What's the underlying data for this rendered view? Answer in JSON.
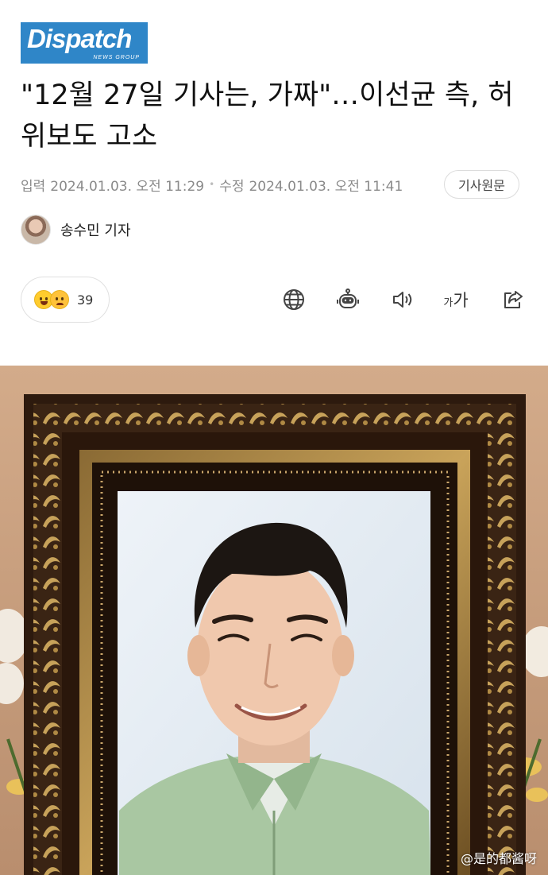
{
  "brand": {
    "logo_text": "Dispatch",
    "logo_sub": "NEWS GROUP"
  },
  "article": {
    "headline": "\"12월 27일 기사는, 가짜\"…이선균 측, 허위보도 고소",
    "meta": {
      "input_label": "입력",
      "input_time": "2024.01.03. 오전 11:29",
      "modified_label": "수정",
      "modified_time": "2024.01.03. 오전 11:41",
      "original_button": "기사원문"
    },
    "author": "송수민 기자",
    "reactions": {
      "count": "39"
    }
  },
  "toolbar": {
    "icons": [
      "globe-icon",
      "robot-icon",
      "speaker-icon",
      "font-size-icon",
      "share-icon"
    ],
    "font_size_small": "가",
    "font_size_large": "가"
  },
  "photo": {
    "watermark": "@是的都酱呀"
  },
  "colors": {
    "brand_blue": "#2f86c8",
    "brand_green": "#7ec242"
  }
}
